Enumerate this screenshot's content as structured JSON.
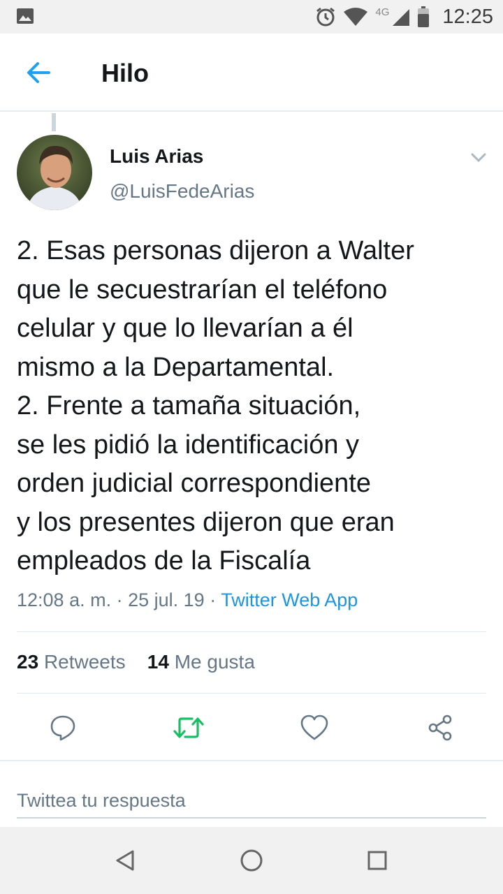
{
  "status_bar": {
    "network": "4G",
    "time": "12:25"
  },
  "header": {
    "title": "Hilo"
  },
  "tweet": {
    "author_name": "Luis Arias",
    "author_handle": "@LuisFedeArias",
    "text_lines": [
      "2. Esas personas dijeron a Walter",
      "que le secuestrarían el teléfono",
      "celular y que lo llevarían a él",
      "mismo a la Departamental.",
      "2. Frente a tamaña situación,",
      "se les pidió la identificación y",
      "orden judicial correspondiente",
      "y los presentes dijeron que eran",
      "empleados de la Fiscalía"
    ],
    "time": "12:08 a. m.",
    "separator": " · ",
    "date": "25 jul. 19",
    "source": "Twitter Web App",
    "retweets_count": "23",
    "retweets_label": "Retweets",
    "likes_count": "14",
    "likes_label": "Me gusta"
  },
  "reply": {
    "placeholder": "Twittea tu respuesta"
  },
  "colors": {
    "accent": "#1da1f2",
    "retweet_green": "#17bf63",
    "icon_gray": "#657786",
    "link_blue": "#1b95e0"
  },
  "icons": {
    "back": "arrow-left-icon",
    "caret": "chevron-down-icon",
    "reply": "comment-icon",
    "retweet": "retweet-icon",
    "like": "heart-icon",
    "share": "share-icon"
  }
}
